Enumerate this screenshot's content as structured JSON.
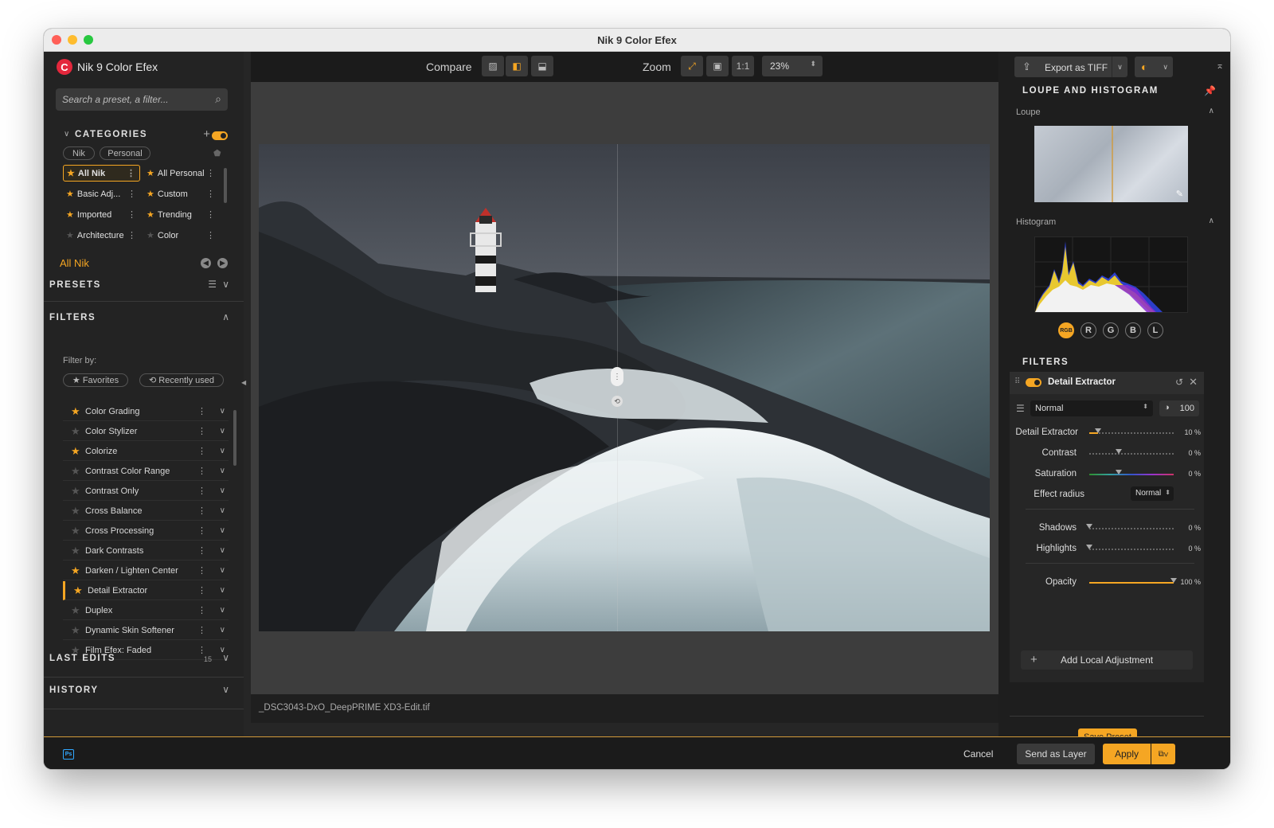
{
  "window": {
    "title": "Nik 9 Color Efex"
  },
  "app": {
    "name": "Nik 9 Color Efex",
    "logo_letter": "C"
  },
  "search": {
    "placeholder": "Search a preset, a filter..."
  },
  "categories": {
    "header": "CATEGORIES",
    "tabs": [
      "Nik",
      "Personal"
    ],
    "items": [
      {
        "label": "All Nik",
        "starred": true,
        "selected": true
      },
      {
        "label": "All Personal",
        "starred": true
      },
      {
        "label": "Basic Adj...",
        "starred": true
      },
      {
        "label": "Custom",
        "starred": true
      },
      {
        "label": "Imported",
        "starred": true
      },
      {
        "label": "Trending",
        "starred": true
      },
      {
        "label": "Architecture",
        "starred": false
      },
      {
        "label": "Color",
        "starred": false
      }
    ],
    "current": "All Nik"
  },
  "presets": {
    "header": "PRESETS"
  },
  "filters_section": {
    "header": "FILTERS",
    "filter_by": "Filter by:",
    "favorites_label": "★ Favorites",
    "recent_label": "⟲ Recently used",
    "items": [
      {
        "label": "Color Grading",
        "fav": true
      },
      {
        "label": "Color Stylizer",
        "fav": false
      },
      {
        "label": "Colorize",
        "fav": true
      },
      {
        "label": "Contrast Color Range",
        "fav": false
      },
      {
        "label": "Contrast Only",
        "fav": false
      },
      {
        "label": "Cross Balance",
        "fav": false
      },
      {
        "label": "Cross Processing",
        "fav": false
      },
      {
        "label": "Dark Contrasts",
        "fav": false
      },
      {
        "label": "Darken / Lighten Center",
        "fav": true
      },
      {
        "label": "Detail Extractor",
        "fav": true,
        "active": true
      },
      {
        "label": "Duplex",
        "fav": false
      },
      {
        "label": "Dynamic Skin Softener",
        "fav": false
      },
      {
        "label": "Film Efex: Faded",
        "fav": false
      }
    ]
  },
  "last_edits": {
    "header": "LAST EDITS",
    "count": "15"
  },
  "history": {
    "header": "HISTORY"
  },
  "toolbar": {
    "compare_label": "Compare",
    "zoom_label": "Zoom",
    "zoom_one": "1:1",
    "zoom_value": "23%"
  },
  "status": {
    "filename": "_DSC3043-DxO_DeepPRIME XD3-Edit.tif"
  },
  "export": {
    "label": "Export as TIFF"
  },
  "loupe_histogram": {
    "header": "LOUPE AND HISTOGRAM",
    "loupe_label": "Loupe",
    "histogram_label": "Histogram",
    "channels": [
      "RGB",
      "R",
      "G",
      "B",
      "L"
    ]
  },
  "filters_panel": {
    "header": "FILTERS",
    "filter_name": "Detail Extractor",
    "blend_mode": "Normal",
    "opacity": "100",
    "controls": [
      {
        "label": "Detail Extractor",
        "value": "10 %",
        "level": 0.1
      },
      {
        "label": "Contrast",
        "value": "0 %",
        "level": 0.35
      },
      {
        "label": "Saturation",
        "value": "0 %",
        "level": 0.35
      }
    ],
    "effect_radius": {
      "label": "Effect radius",
      "value": "Normal"
    },
    "tone": [
      {
        "label": "Shadows",
        "value": "0 %",
        "level": 0.0
      },
      {
        "label": "Highlights",
        "value": "0 %",
        "level": 0.0
      }
    ],
    "opacity_control": {
      "label": "Opacity",
      "value": "100 %",
      "level": 1.0
    },
    "add_local": "Add Local Adjustment"
  },
  "save_preset": "Save Preset",
  "actions": {
    "ps_label": "Ps",
    "cancel": "Cancel",
    "send_layer": "Send as Layer",
    "apply": "Apply"
  },
  "colors": {
    "accent": "#f5a623",
    "background": "#262626",
    "panel": "#1e1e1e"
  }
}
